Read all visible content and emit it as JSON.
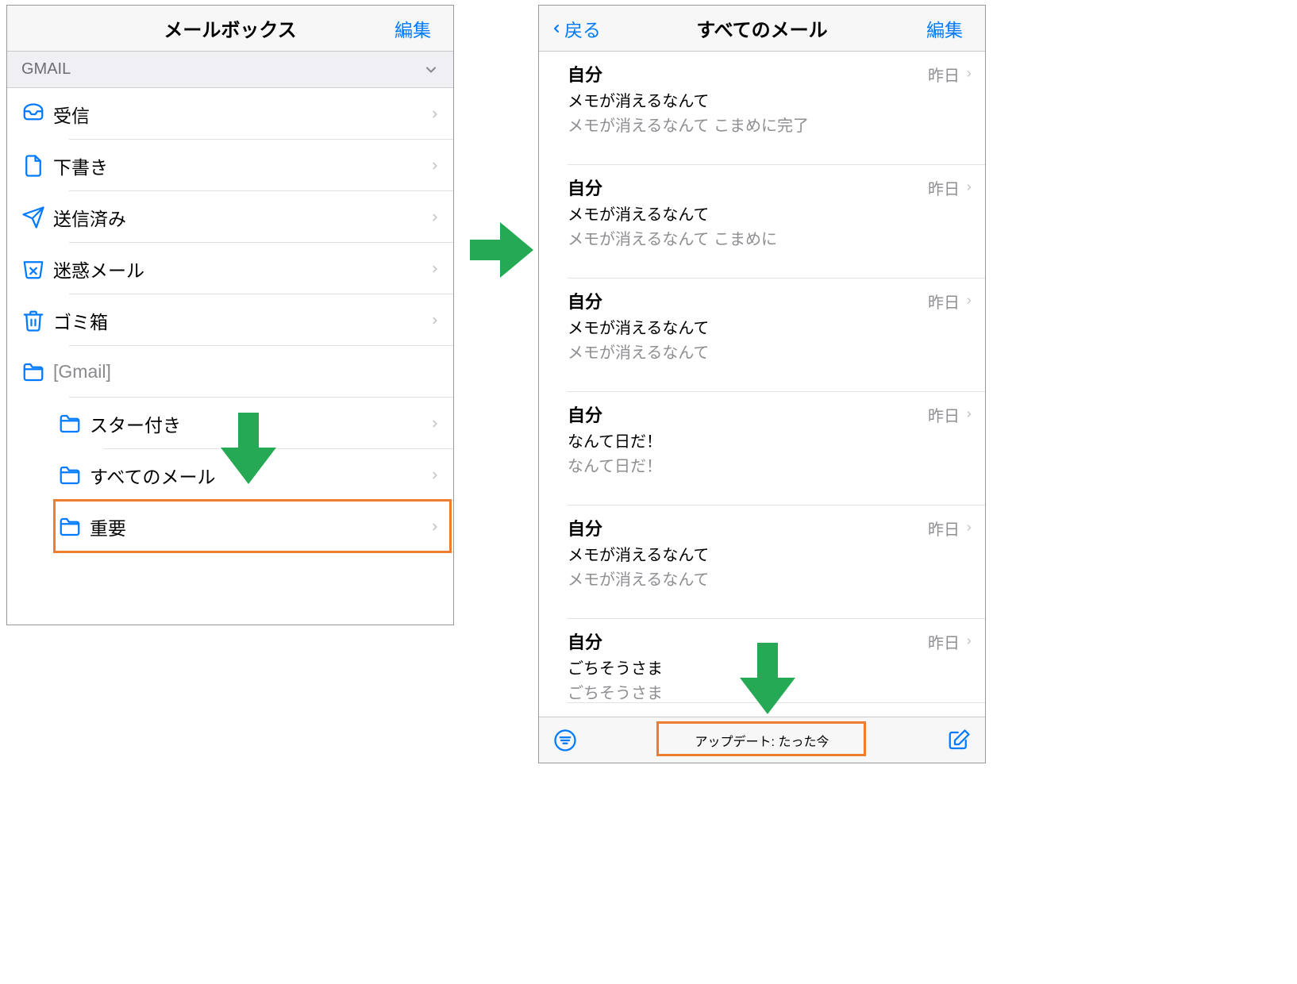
{
  "left": {
    "title": "メールボックス",
    "edit": "編集",
    "section": "GMAIL",
    "rows": [
      {
        "icon": "inbox",
        "label": "受信"
      },
      {
        "icon": "doc",
        "label": "下書き"
      },
      {
        "icon": "send",
        "label": "送信済み"
      },
      {
        "icon": "junk",
        "label": "迷惑メール"
      },
      {
        "icon": "trash",
        "label": "ゴミ箱"
      },
      {
        "icon": "folder",
        "label": "[Gmail]",
        "dim": true,
        "noChevron": true
      }
    ],
    "subrows": [
      {
        "icon": "folder",
        "label": "スター付き"
      },
      {
        "icon": "folder",
        "label": "すべてのメール",
        "highlight": true
      },
      {
        "icon": "folder",
        "label": "重要"
      }
    ]
  },
  "right": {
    "back": "戻る",
    "title": "すべてのメール",
    "edit": "編集",
    "messages": [
      {
        "sender": "自分",
        "date": "昨日",
        "subject": "メモが消えるなんて",
        "preview": "メモが消えるなんて こまめに完了"
      },
      {
        "sender": "自分",
        "date": "昨日",
        "subject": "メモが消えるなんて",
        "preview": "メモが消えるなんて こまめに"
      },
      {
        "sender": "自分",
        "date": "昨日",
        "subject": "メモが消えるなんて",
        "preview": "メモが消えるなんて"
      },
      {
        "sender": "自分",
        "date": "昨日",
        "subject": "なんて日だ！",
        "preview": "なんて日だ！"
      },
      {
        "sender": "自分",
        "date": "昨日",
        "subject": "メモが消えるなんて",
        "preview": "メモが消えるなんて"
      },
      {
        "sender": "自分",
        "date": "昨日",
        "subject": "ごちそうさま",
        "preview": "ごちそうさま"
      }
    ],
    "status": "アップデート: たった今"
  }
}
